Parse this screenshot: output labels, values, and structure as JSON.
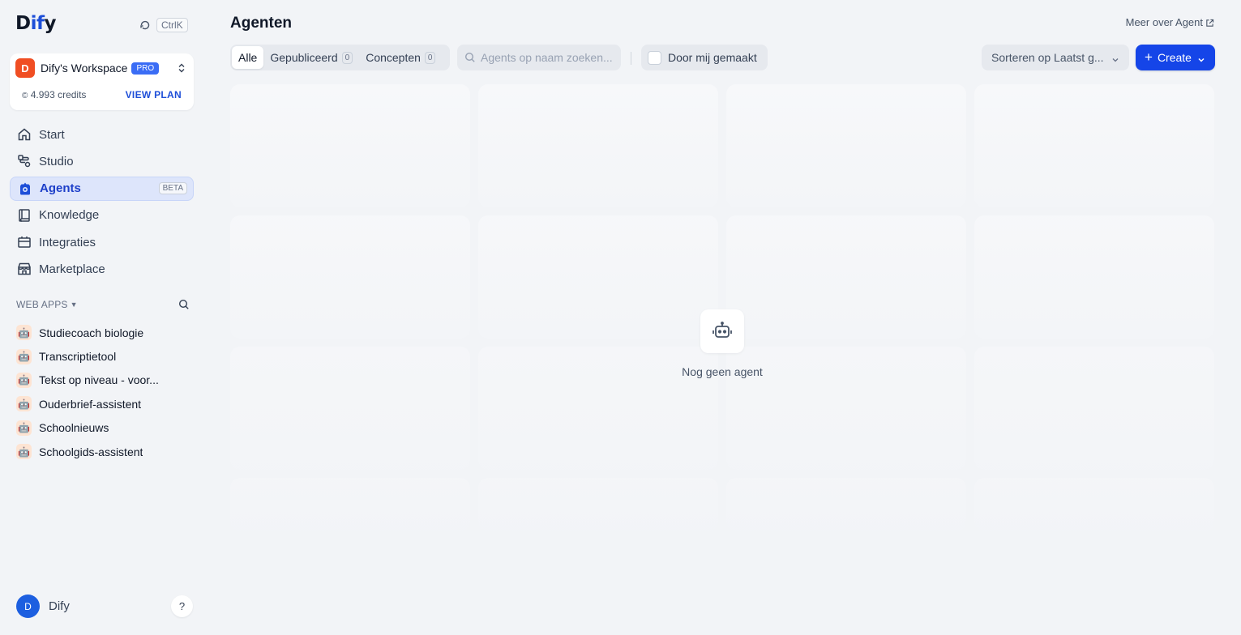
{
  "sidebar": {
    "logo": {
      "pre": "D",
      "hl": "if",
      "post": "y"
    },
    "search_shortcut": "CtrlK",
    "workspace": {
      "initial": "D",
      "name": "Dify's Workspace",
      "plan_badge": "PRO",
      "credits": "4.993 credits",
      "view_plan": "VIEW PLAN"
    },
    "nav": [
      {
        "label": "Start",
        "icon": "home-icon"
      },
      {
        "label": "Studio",
        "icon": "studio-icon"
      },
      {
        "label": "Agents",
        "icon": "agent-icon",
        "badge": "BETA",
        "active": true
      },
      {
        "label": "Knowledge",
        "icon": "book-icon"
      },
      {
        "label": "Integraties",
        "icon": "integrations-icon"
      },
      {
        "label": "Marketplace",
        "icon": "store-icon"
      }
    ],
    "web_apps_title": "WEB APPS",
    "web_apps": [
      "Studiecoach biologie",
      "Transcriptietool",
      "Tekst op niveau - voor...",
      "Ouderbrief-assistent",
      "Schoolnieuws",
      "Schoolgids-assistent"
    ],
    "user": {
      "initial": "D",
      "name": "Dify"
    },
    "help": "?"
  },
  "main": {
    "title": "Agenten",
    "about_link": "Meer over Agent",
    "tabs": [
      {
        "label": "Alle",
        "active": true
      },
      {
        "label": "Gepubliceerd",
        "count": "0"
      },
      {
        "label": "Concepten",
        "count": "0"
      }
    ],
    "search_placeholder": "Agents op naam zoeken...",
    "mine_filter": "Door mij gemaakt",
    "sort_label": "Sorteren op Laatst g...",
    "create_label": "Create",
    "empty_text": "Nog geen agent"
  },
  "colors": {
    "accent": "#1545e8",
    "background": "#f2f4f7",
    "workspace_avatar": "#f04e23",
    "pro_badge": "#3b6df5"
  }
}
